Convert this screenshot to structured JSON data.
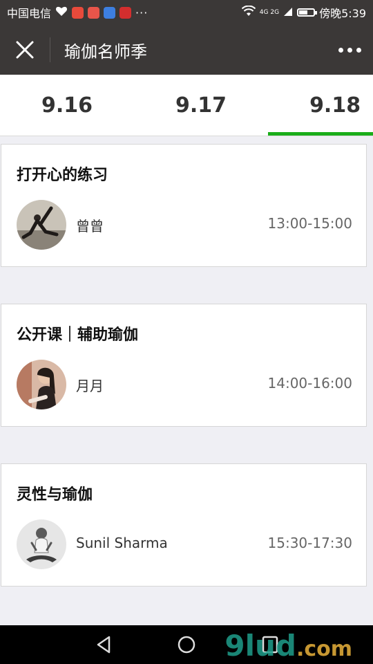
{
  "status_bar": {
    "carrier": "中国电信",
    "more": "···",
    "network": "4G 2G",
    "time": "傍晚5:39"
  },
  "header": {
    "title": "瑜伽名师季"
  },
  "tabs": [
    {
      "label": "9.16",
      "active": false
    },
    {
      "label": "9.17",
      "active": false
    },
    {
      "label": "9.18",
      "active": true
    }
  ],
  "sessions": [
    {
      "title": "打开心的练习",
      "teacher": "曾曾",
      "time": "13:00-15:00"
    },
    {
      "title": "公开课｜辅助瑜伽",
      "teacher": "月月",
      "time": "14:00-16:00"
    },
    {
      "title": "灵性与瑜伽",
      "teacher": "Sunil Sharma",
      "time": "15:30-17:30"
    }
  ],
  "watermark": {
    "main": "9lud",
    "suffix": ".com"
  },
  "colors": {
    "header_bg": "#3b3837",
    "tab_active": "#1aad19",
    "page_bg": "#efeff4"
  }
}
